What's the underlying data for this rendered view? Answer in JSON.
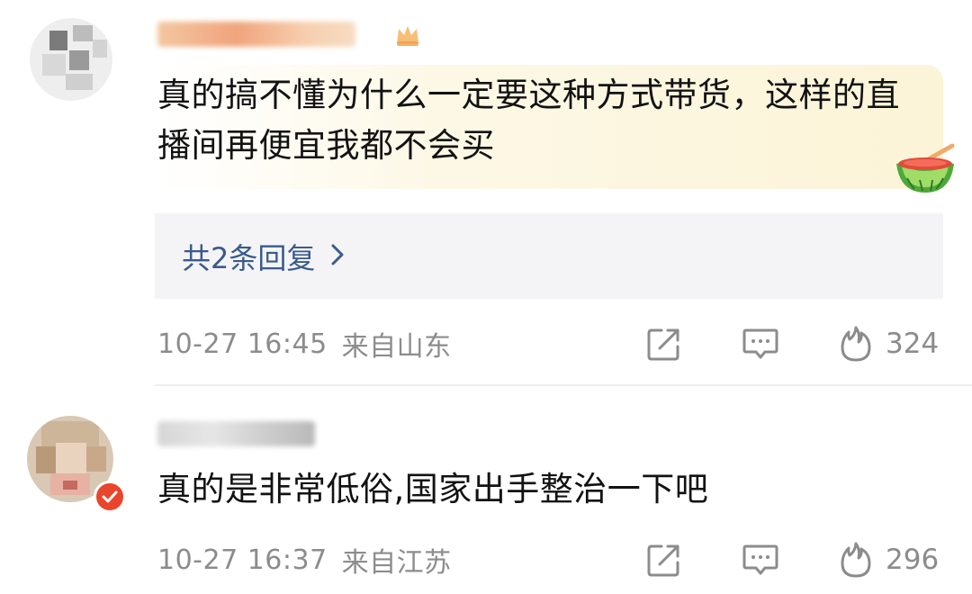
{
  "comments": [
    {
      "text": "真的搞不懂为什么一定要这种方式带货，这样的直播间再便宜我都不会买",
      "replies_label": "共2条回复",
      "timestamp": "10-27 16:45",
      "location": "来自山东",
      "like_count": "324",
      "name_colors": [
        "#f2c49c",
        "#f4a97e",
        "#f6d2b0"
      ],
      "icons": {
        "share": "share-icon",
        "comment": "comment-icon",
        "like": "flame-icon",
        "badge": "crown-badge-icon",
        "emoji": "watermelon-icon"
      }
    },
    {
      "text": "真的是非常低俗,国家出手整治一下吧",
      "timestamp": "10-27 16:37",
      "location": "来自江苏",
      "like_count": "296",
      "name_colors": [
        "#c8c8c8",
        "#dddddd"
      ],
      "icons": {
        "share": "share-icon",
        "comment": "comment-icon",
        "like": "flame-icon",
        "badge": "verified-badge-icon"
      }
    }
  ],
  "colors": {
    "link": "#3a5a8c",
    "meta": "#8c8c8c",
    "badge_red": "#e8452c"
  }
}
